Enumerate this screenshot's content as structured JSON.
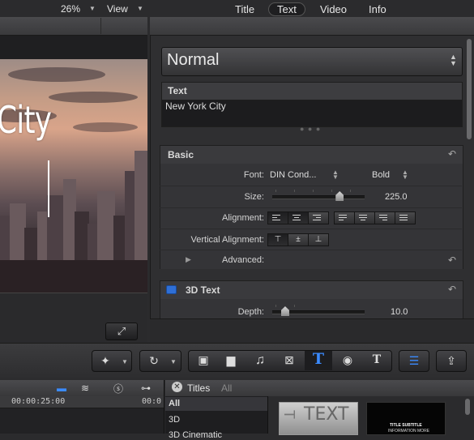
{
  "viewer": {
    "zoom": "26%",
    "view_label": "View",
    "overlay_text": "City"
  },
  "inspector": {
    "tabs": [
      "Title",
      "Text",
      "Video",
      "Info"
    ],
    "active_tab": "Text",
    "preset": "Normal",
    "text_section": {
      "label": "Text",
      "value": "New York City"
    },
    "basic": {
      "title": "Basic",
      "font_label": "Font:",
      "font_value": "DIN Cond...",
      "font_style": "Bold",
      "size_label": "Size:",
      "size_value": "225.0",
      "size_slider_fraction": 0.73,
      "alignment_label": "Alignment:",
      "vertical_alignment_label": "Vertical Alignment:",
      "advanced_label": "Advanced:"
    },
    "text3d": {
      "title": "3D Text",
      "depth_label": "Depth:",
      "depth_value": "10.0",
      "depth_slider_fraction": 0.14
    }
  },
  "timeline": {
    "timecode_1": "00:00:25:00",
    "timecode_2": "00:0"
  },
  "browser": {
    "title": "Titles",
    "filter": "All",
    "categories": [
      "All",
      "3D",
      "3D Cinematic"
    ],
    "thumb1_text": "TEXT",
    "thumb2_line1": "TITLE SUBTITLE",
    "thumb2_line2": "INFORMATION MORE"
  },
  "colors": {
    "accent_blue": "#2f6fd6",
    "active_tool_blue": "#3b8bff"
  }
}
